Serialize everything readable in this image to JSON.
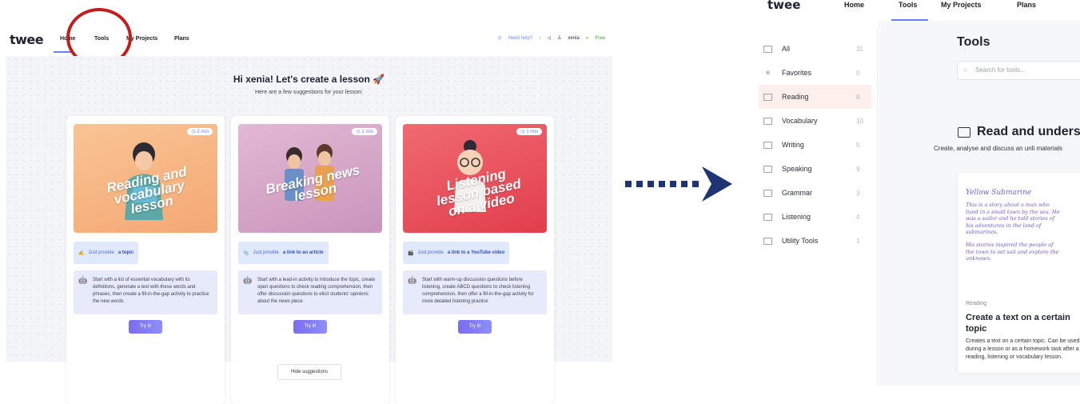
{
  "left": {
    "logo": "twee",
    "nav": [
      "Home",
      "Tools",
      "My Projects",
      "Plans"
    ],
    "help": "Need help?",
    "user": "xenia",
    "badge": "Free",
    "headline": "Hi xenia! Let's create a lesson",
    "subheadline": "Here are a few suggestions for your lesson:",
    "cards": [
      {
        "time": "2 min",
        "thumb_title": "Reading and vocabulary lesson",
        "tip_prefix": "Just provide",
        "tip_bold": "a topic",
        "description": "Start with a list of essential vocabulary with its definitions, generate a text with these words and phrases, then create a fill-in-the-gap activity to practice the new words",
        "button": "Try it!",
        "color": "#f8b784"
      },
      {
        "time": "1 min",
        "thumb_title": "Breaking news lesson",
        "tip_prefix": "Just provide",
        "tip_bold": "a link to an article",
        "description": "Start with a lead-in activity to introduce the topic, create open questions to check reading comprehension, then offer discussion questions to elicit students' opinions about the news piece",
        "button": "Try it!",
        "color": "#d8a6c9"
      },
      {
        "time": "1 min",
        "thumb_title": "Listening lesson based on a video",
        "tip_prefix": "Just provide",
        "tip_bold": "a link to a YouTube video",
        "description": "Start with warm-up discussion questions before listening, create ABCD questions to check listening comprehension, then offer a fill-in-the-gap activity for more detailed listening practice",
        "button": "Try it!",
        "color": "#e94b57"
      }
    ],
    "hide_button": "Hide suggestions"
  },
  "right": {
    "logo": "twee",
    "nav": [
      "Home",
      "Tools",
      "My Projects",
      "Plans"
    ],
    "categories": [
      {
        "label": "All",
        "count": "31"
      },
      {
        "label": "Favorites",
        "count": "0"
      },
      {
        "label": "Reading",
        "count": "8"
      },
      {
        "label": "Vocabulary",
        "count": "10"
      },
      {
        "label": "Writing",
        "count": "5"
      },
      {
        "label": "Speaking",
        "count": "9"
      },
      {
        "label": "Grammar",
        "count": "3"
      },
      {
        "label": "Listening",
        "count": "4"
      },
      {
        "label": "Utility Tools",
        "count": "1"
      }
    ],
    "title": "Tools",
    "search_placeholder": "Search for tools...",
    "section_title": "Read and unders",
    "section_desc": "Create, analyse and discuss an unli materials",
    "card": {
      "hw_title": "Yellow Submarine",
      "hw_line1": "This is a story about a man who lived in a small town by the sea. He was a sailor and he told stories of his adventures in the land of submarines.",
      "hw_line2": "His stories inspired the people of the town to set sail and explore the unknown.",
      "category": "Reading",
      "title": "Create a text on a certain topic",
      "desc": "Creates a text on a certain topic. Can be used during a lesson or as a homework task after a reading, listening or vocabulary lesson."
    }
  }
}
